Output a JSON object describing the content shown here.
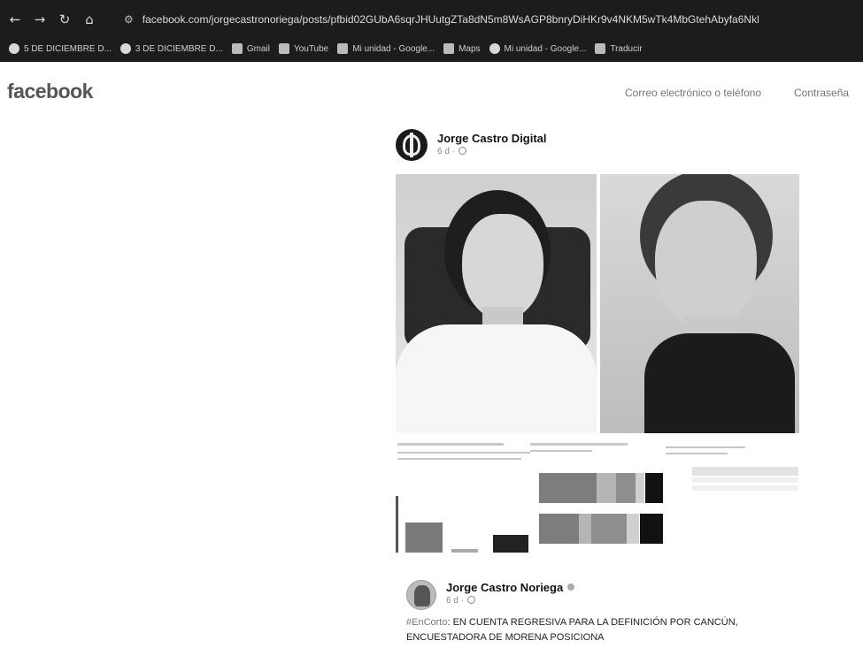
{
  "browser": {
    "url": "facebook.com/jorgecastronoriega/posts/pfbid02GUbA6sqrJHUutgZTa8dN5m8WsAGP8bnryDiHKr9v4NKM5wTk4MbGtehAbyfa6Nkl",
    "bookmarks": [
      {
        "label": "5 DE DICIEMBRE D...",
        "icon": "globe-icon"
      },
      {
        "label": "3 DE DICIEMBRE D...",
        "icon": "globe-icon"
      },
      {
        "label": "Gmail",
        "icon": "gmail-icon"
      },
      {
        "label": "YouTube",
        "icon": "youtube-icon"
      },
      {
        "label": "Mi unidad - Google...",
        "icon": "drive-icon"
      },
      {
        "label": "Maps",
        "icon": "maps-icon"
      },
      {
        "label": "Mi unidad - Google...",
        "icon": "drive-icon"
      },
      {
        "label": "Traducir",
        "icon": "translate-icon"
      }
    ]
  },
  "header": {
    "logo": "facebook",
    "email_placeholder": "Correo electrónico o teléfono",
    "password_placeholder": "Contraseña"
  },
  "post": {
    "page_name": "Jorge Castro Digital",
    "time": "6 d ·"
  },
  "comment": {
    "author": "Jorge Castro Noriega",
    "time": "6 d ·",
    "hashtag": "#EnCorto",
    "text": ": EN CUENTA REGRESIVA PARA LA DEFINICIÓN POR CANCÚN, ENCUESTADORA DE MORENA POSICIONA"
  }
}
